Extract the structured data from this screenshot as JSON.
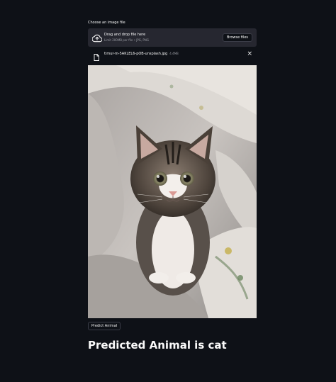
{
  "uploader": {
    "label": "Choose an image file",
    "drop_title": "Drag and drop file here",
    "drop_hint": "Limit 200MB per file • JPG, PNG",
    "browse_label": "Browse files"
  },
  "uploaded_file": {
    "name": "timur-m-5AKLEL6-pOB-unsplash.jpg",
    "size": "4.4MB"
  },
  "predict_button": {
    "label": "Predict Animal"
  },
  "result": {
    "text": "Predicted Animal is cat"
  },
  "icons": {
    "upload": "cloud-upload-icon",
    "file": "file-icon",
    "close": "close-icon"
  },
  "colors": {
    "background": "#0e1117",
    "dropzone": "#262730",
    "text": "#fafafa",
    "muted": "#9a9ca3"
  }
}
